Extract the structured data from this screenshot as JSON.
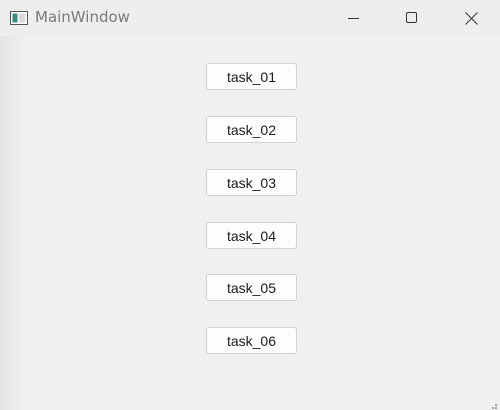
{
  "window": {
    "title": "MainWindow",
    "controls": {
      "minimize_icon": "minimize-icon",
      "maximize_icon": "maximize-icon",
      "close_icon": "close-icon"
    }
  },
  "tasks": [
    {
      "label": "task_01"
    },
    {
      "label": "task_02"
    },
    {
      "label": "task_03"
    },
    {
      "label": "task_04"
    },
    {
      "label": "task_05"
    },
    {
      "label": "task_06"
    }
  ],
  "colors": {
    "background": "#f0f0f0",
    "title_text": "#7a7a7a",
    "button_face": "#fdfdfd",
    "button_border": "#d0d0d0"
  }
}
